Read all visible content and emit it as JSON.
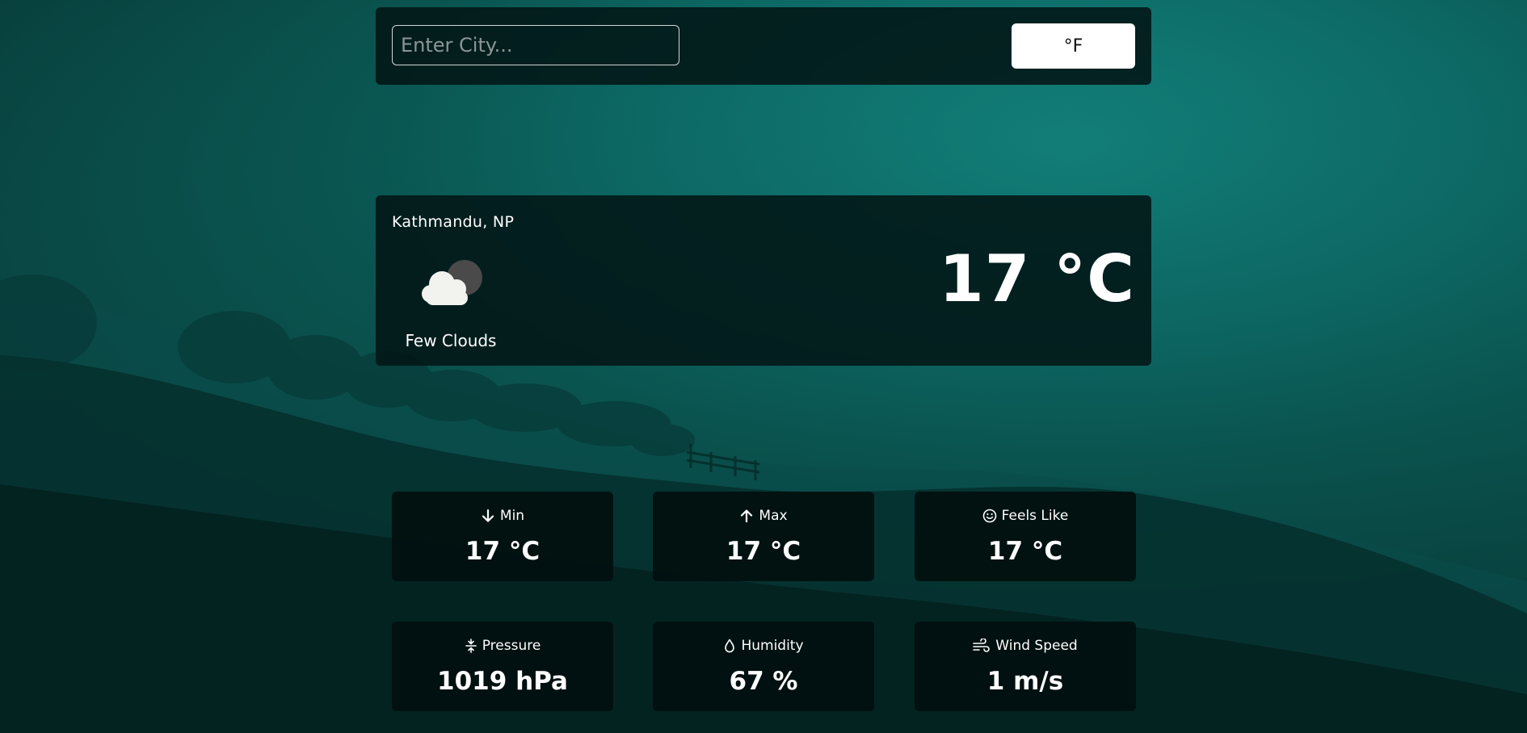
{
  "search": {
    "placeholder": "Enter City...",
    "value": ""
  },
  "unit_toggle": {
    "label": "°F"
  },
  "current": {
    "location": "Kathmandu, NP",
    "icon": "few-clouds-night-icon",
    "condition": "Few Clouds",
    "temperature": "17 °C"
  },
  "stats": {
    "min": {
      "label": "Min",
      "value": "17 °C",
      "icon": "arrow-down-icon"
    },
    "max": {
      "label": "Max",
      "value": "17 °C",
      "icon": "arrow-up-icon"
    },
    "feels_like": {
      "label": "Feels Like",
      "value": "17 °C",
      "icon": "smiley-icon"
    },
    "pressure": {
      "label": "Pressure",
      "value": "1019 hPa",
      "icon": "pressure-icon"
    },
    "humidity": {
      "label": "Humidity",
      "value": "67 %",
      "icon": "droplet-icon"
    },
    "wind_speed": {
      "label": "Wind Speed",
      "value": "1 m/s",
      "icon": "wind-icon"
    }
  },
  "colors": {
    "background_teal": "#0d6a66",
    "card_dark": "#021616",
    "button_white": "#ffffff"
  }
}
